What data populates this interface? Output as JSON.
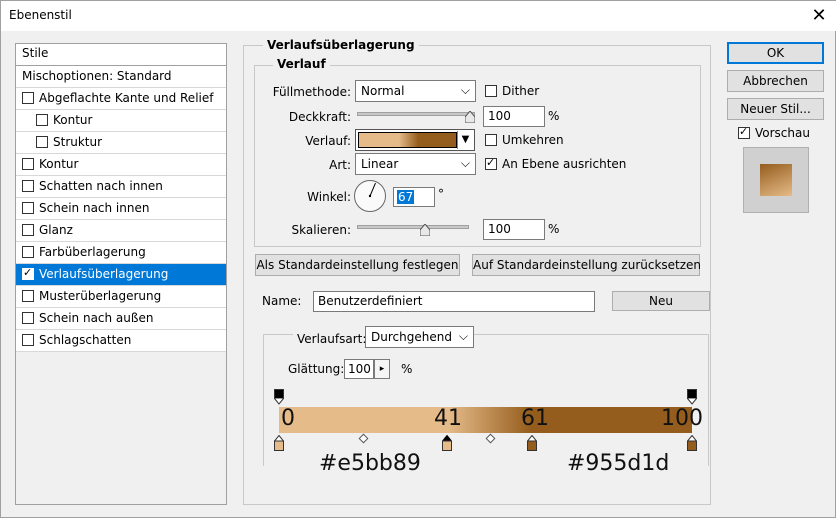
{
  "window": {
    "title": "Ebenenstil",
    "close_icon": "close-icon"
  },
  "styles_panel": {
    "header": "Stile",
    "blend_options": "Mischoptionen: Standard",
    "items": [
      {
        "label": "Abgeflachte Kante und Relief",
        "checked": false,
        "indent": false,
        "selected": false
      },
      {
        "label": "Kontur",
        "checked": false,
        "indent": true,
        "selected": false
      },
      {
        "label": "Struktur",
        "checked": false,
        "indent": true,
        "selected": false
      },
      {
        "label": "Kontur",
        "checked": false,
        "indent": false,
        "selected": false
      },
      {
        "label": "Schatten nach innen",
        "checked": false,
        "indent": false,
        "selected": false
      },
      {
        "label": "Schein nach innen",
        "checked": false,
        "indent": false,
        "selected": false
      },
      {
        "label": "Glanz",
        "checked": false,
        "indent": false,
        "selected": false
      },
      {
        "label": "Farbüberlagerung",
        "checked": false,
        "indent": false,
        "selected": false
      },
      {
        "label": "Verlaufsüberlagerung",
        "checked": true,
        "indent": false,
        "selected": true
      },
      {
        "label": "Musterüberlagerung",
        "checked": false,
        "indent": false,
        "selected": false
      },
      {
        "label": "Schein nach außen",
        "checked": false,
        "indent": false,
        "selected": false
      },
      {
        "label": "Schlagschatten",
        "checked": false,
        "indent": false,
        "selected": false
      }
    ]
  },
  "main": {
    "section_title": "Verlaufsüberlagerung",
    "subsection_title": "Verlauf",
    "blend_mode": {
      "label": "Füllmethode:",
      "value": "Normal"
    },
    "dither": {
      "label": "Dither",
      "checked": false
    },
    "opacity": {
      "label": "Deckkraft:",
      "value": "100",
      "unit": "%",
      "level": 1.0
    },
    "gradient": {
      "label": "Verlauf:"
    },
    "reverse": {
      "label": "Umkehren",
      "checked": false
    },
    "style": {
      "label": "Art:",
      "value": "Linear"
    },
    "align": {
      "label": "An Ebene ausrichten",
      "checked": true
    },
    "angle": {
      "label": "Winkel:",
      "value": "67",
      "unit": "°"
    },
    "scale": {
      "label": "Skalieren:",
      "value": "100",
      "unit": "%",
      "level": 0.5
    },
    "make_default": "Als Standardeinstellung festlegen",
    "reset_default": "Auf Standardeinstellung zurücksetzen"
  },
  "editor": {
    "name_label": "Name:",
    "name_value": "Benutzerdefiniert",
    "new_button": "Neu",
    "gradient_type_label": "Verlaufsart:",
    "gradient_type_value": "Durchgehend",
    "smoothness_label": "Glättung:",
    "smoothness_value": "100",
    "smoothness_unit": "%",
    "stop_labels": [
      "0",
      "41",
      "61",
      "100"
    ],
    "hex_left": "#e5bb89",
    "hex_right": "#955d1d",
    "colors": {
      "start": "#e5bb89",
      "end": "#955d1d"
    }
  },
  "buttons": {
    "ok": "OK",
    "cancel": "Abbrechen",
    "new_style": "Neuer Stil...",
    "preview_label": "Vorschau",
    "preview_checked": true
  }
}
